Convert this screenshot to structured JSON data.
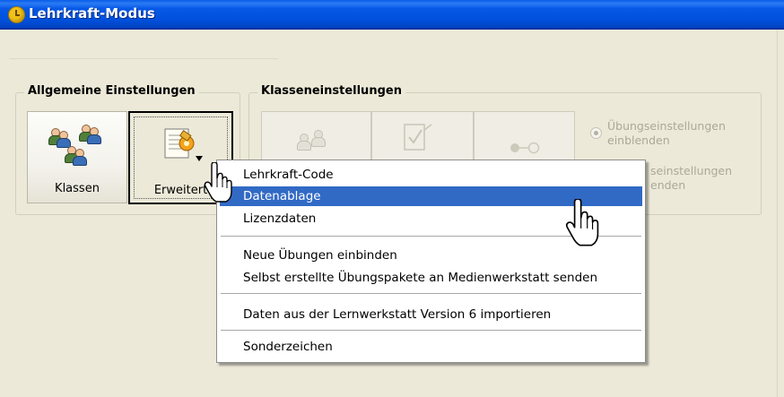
{
  "window": {
    "title": "Lehrkraft-Modus"
  },
  "general_settings": {
    "legend": "Allgemeine Einstellungen",
    "buttons": [
      {
        "label": "Klassen",
        "icon": "users-group-icon"
      },
      {
        "label": "Erweitert",
        "icon": "settings-tools-icon",
        "state": "pressed"
      }
    ]
  },
  "class_settings": {
    "legend": "Klasseneinstellungen",
    "radio_options": [
      {
        "line1": "Übungseinstellungen",
        "line2": "einblenden",
        "selected": true,
        "enabled": false
      },
      {
        "line1": "seinstellungen",
        "line2": "enden",
        "selected": false,
        "enabled": false
      }
    ]
  },
  "context_menu": {
    "items": [
      {
        "label": "Lehrkraft-Code"
      },
      {
        "label": "Datenablage",
        "highlighted": true
      },
      {
        "label": "Lizenzdaten"
      },
      {
        "label": "Neue Übungen einbinden"
      },
      {
        "label": "Selbst erstellte Übungspakete an Medienwerkstatt senden"
      },
      {
        "label": "Daten aus der Lernwerkstatt Version 6 importieren"
      },
      {
        "label": "Sonderzeichen"
      }
    ]
  },
  "colors": {
    "title_bar": "#0054e3",
    "menu_highlight": "#316ac5",
    "window_bg": "#ece9d8"
  }
}
